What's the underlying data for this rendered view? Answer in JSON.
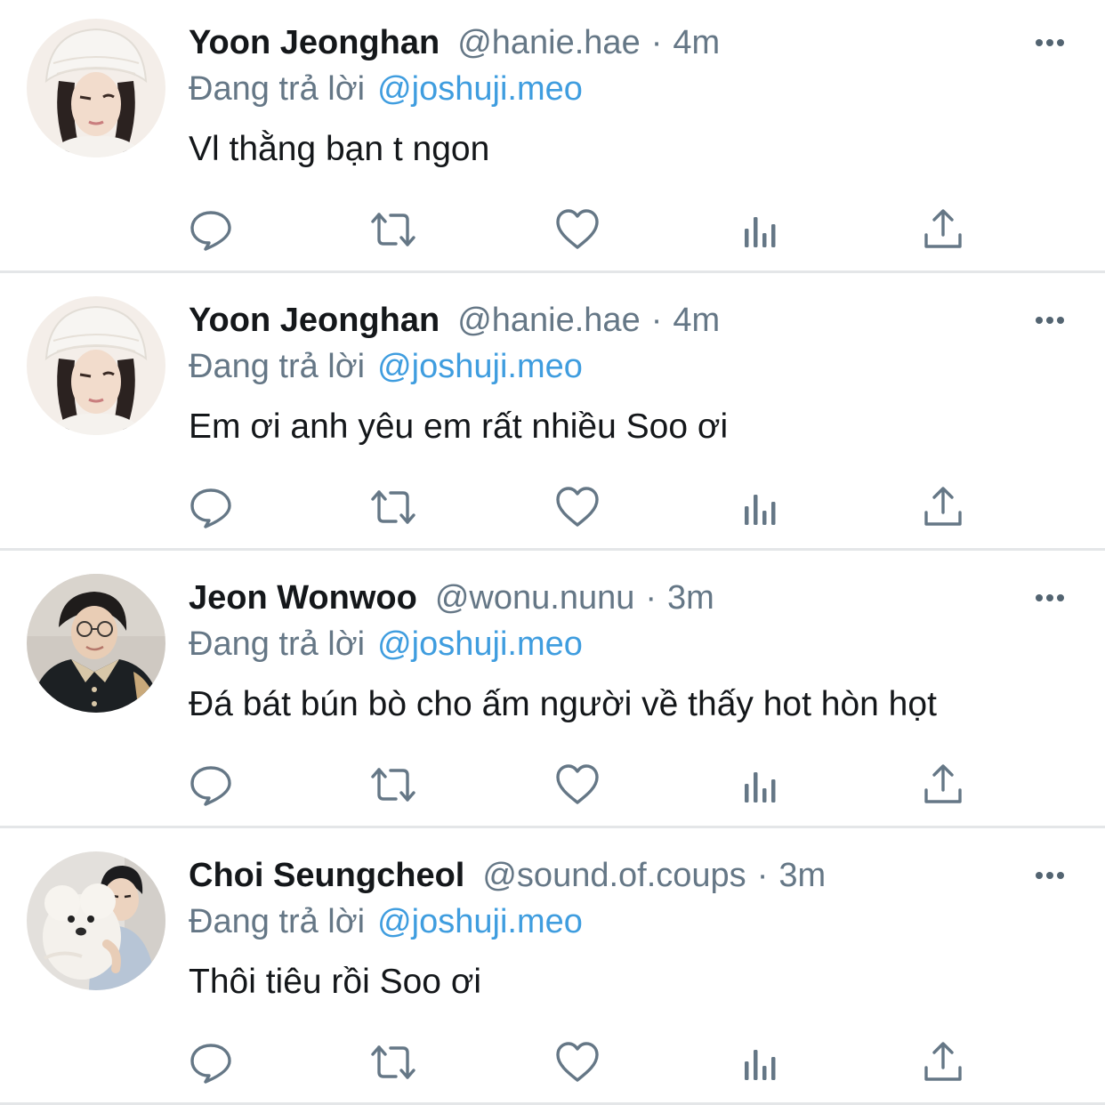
{
  "tweets": [
    {
      "display_name": "Yoon Jeonghan",
      "handle": "@hanie.hae",
      "separator": "·",
      "time": "4m",
      "replying_label": "Đang trả lời",
      "replying_to": "@joshuji.meo",
      "text": "Vl thằng bạn t ngon",
      "avatar_icon": "avatar-white-beanie"
    },
    {
      "display_name": "Yoon Jeonghan",
      "handle": "@hanie.hae",
      "separator": "·",
      "time": "4m",
      "replying_label": "Đang trả lời",
      "replying_to": "@joshuji.meo",
      "text": "Em ơi anh yêu em rất nhiều Soo ơi",
      "avatar_icon": "avatar-white-beanie"
    },
    {
      "display_name": "Jeon Wonwoo",
      "handle": "@wonu.nunu",
      "separator": "·",
      "time": "3m",
      "replying_label": "Đang trả lời",
      "replying_to": "@joshuji.meo",
      "text": "Đá bát bún bò cho ấm người về thấy hot hòn họt",
      "avatar_icon": "avatar-glasses-jacket"
    },
    {
      "display_name": "Choi Seungcheol",
      "handle": "@sound.of.coups",
      "separator": "·",
      "time": "3m",
      "replying_label": "Đang trả lời",
      "replying_to": "@joshuji.meo",
      "text": "Thôi tiêu rồi Soo ơi",
      "avatar_icon": "avatar-with-white-dog"
    }
  ],
  "actions": {
    "reply_icon": "reply-icon",
    "retweet_icon": "retweet-icon",
    "like_icon": "heart-icon",
    "stats_icon": "analytics-icon",
    "share_icon": "share-icon"
  },
  "colors": {
    "name": "#14171a",
    "secondary": "#657786",
    "mention": "#3f9ddf",
    "icon": "#657786",
    "divider": "#e4e6e8"
  }
}
